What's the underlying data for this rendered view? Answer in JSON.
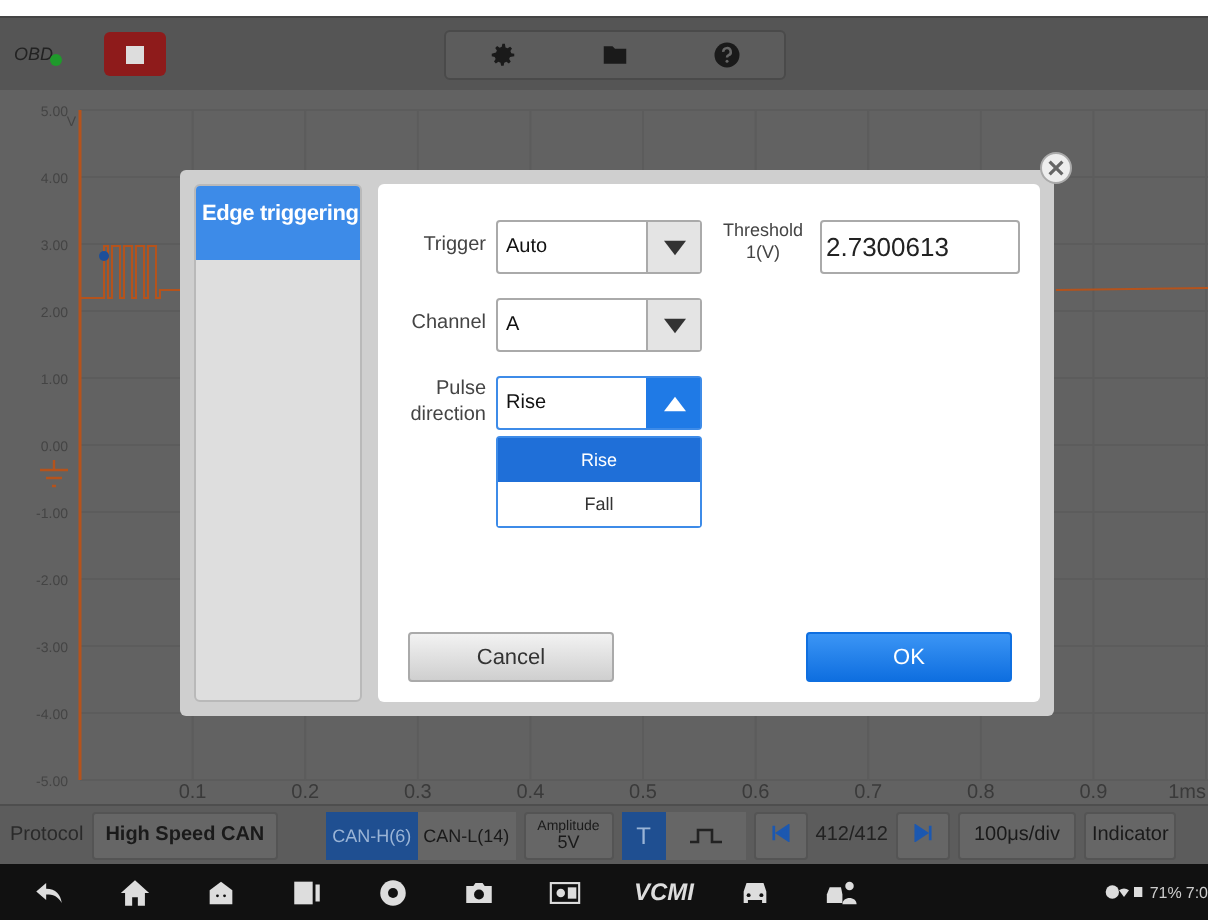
{
  "top_bar": {
    "connection_label": "OBD",
    "connected": true
  },
  "chart": {
    "y_unit": "V",
    "y_labels": [
      "5.00",
      "4.00",
      "3.00",
      "2.00",
      "1.00",
      "0.00",
      "-1.00",
      "-2.00",
      "-3.00",
      "-4.00",
      "-5.00"
    ],
    "x_labels": [
      "0.1",
      "0.2",
      "0.3",
      "0.4",
      "0.5",
      "0.6",
      "0.7",
      "0.8",
      "0.9",
      "1ms"
    ]
  },
  "dialog": {
    "tabs": [
      {
        "label": "Edge triggering",
        "selected": true
      }
    ],
    "fields": [
      {
        "label": "Trigger",
        "value": "Auto",
        "expanded": false
      },
      {
        "label": "Channel",
        "value": "A",
        "expanded": false
      },
      {
        "label": "Pulse direction",
        "value": "Rise",
        "expanded": true,
        "options": [
          {
            "label": "Rise",
            "selected": true
          },
          {
            "label": "Fall",
            "selected": false
          }
        ]
      }
    ],
    "threshold": {
      "label": "Threshold 1(V)",
      "value": "2.7300613"
    },
    "buttons": [
      {
        "label": "Cancel",
        "kind": "secondary"
      },
      {
        "label": "OK",
        "kind": "primary"
      }
    ]
  },
  "bottom_bar": {
    "protocol_label": "Protocol",
    "protocol": "High Speed CAN",
    "channels": [
      {
        "label": "CAN-H(6)",
        "selected": true
      },
      {
        "label": "CAN-L(14)",
        "selected": false
      }
    ],
    "amplitude_label": "Amplitude",
    "amplitude": "5V",
    "modes": [
      {
        "kind": "text",
        "label": "T",
        "selected": true
      },
      {
        "kind": "pulse",
        "selected": false
      }
    ],
    "frame": "412/412",
    "timebase": "100μs/div",
    "indicator": "Indicator"
  },
  "system_bar": {
    "vci_label": "VCMI",
    "battery": "71%",
    "time": "7:0"
  }
}
